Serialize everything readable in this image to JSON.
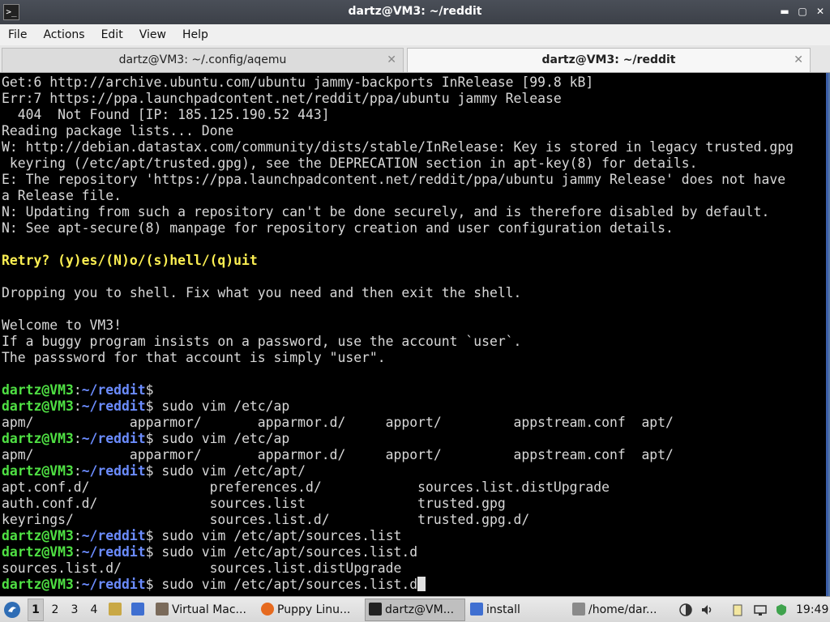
{
  "window": {
    "title": "dartz@VM3: ~/reddit",
    "app_icon": "terminal-icon",
    "buttons": [
      "minimize-icon",
      "maximize-icon",
      "close-icon"
    ]
  },
  "menu": [
    "File",
    "Actions",
    "Edit",
    "View",
    "Help"
  ],
  "tabs": [
    {
      "label": "dartz@VM3: ~/.config/aqemu",
      "active": false
    },
    {
      "label": "dartz@VM3: ~/reddit",
      "active": true
    }
  ],
  "terminal": {
    "prompt_user": "dartz@VM3",
    "prompt_path": "~/reddit",
    "lines": [
      {
        "t": "Get:6 http://archive.ubuntu.com/ubuntu jammy-backports InRelease [99.8 kB]"
      },
      {
        "t": "Err:7 https://ppa.launchpadcontent.net/reddit/ppa/ubuntu jammy Release"
      },
      {
        "t": "  404  Not Found [IP: 185.125.190.52 443]"
      },
      {
        "t": "Reading package lists... Done"
      },
      {
        "t": "W: http://debian.datastax.com/community/dists/stable/InRelease: Key is stored in legacy trusted.gpg"
      },
      {
        "t": " keyring (/etc/apt/trusted.gpg), see the DEPRECATION section in apt-key(8) for details."
      },
      {
        "t": "E: The repository 'https://ppa.launchpadcontent.net/reddit/ppa/ubuntu jammy Release' does not have"
      },
      {
        "t": "a Release file."
      },
      {
        "t": "N: Updating from such a repository can't be done securely, and is therefore disabled by default."
      },
      {
        "t": "N: See apt-secure(8) manpage for repository creation and user configuration details."
      },
      {
        "t": ""
      },
      {
        "t": "Retry? (y)es/(N)o/(s)hell/(q)uit",
        "style": "yellow"
      },
      {
        "t": ""
      },
      {
        "t": "Dropping you to shell. Fix what you need and then exit the shell."
      },
      {
        "t": ""
      },
      {
        "t": "Welcome to VM3!"
      },
      {
        "t": "If a buggy program insists on a password, use the account `user`."
      },
      {
        "t": "The passsword for that account is simply \"user\"."
      },
      {
        "t": ""
      },
      {
        "prompt": true,
        "cmd": ""
      },
      {
        "prompt": true,
        "cmd": " sudo vim /etc/ap"
      },
      {
        "t": "apm/            apparmor/       apparmor.d/     apport/         appstream.conf  apt/"
      },
      {
        "prompt": true,
        "cmd": " sudo vim /etc/ap"
      },
      {
        "t": "apm/            apparmor/       apparmor.d/     apport/         appstream.conf  apt/"
      },
      {
        "prompt": true,
        "cmd": " sudo vim /etc/apt/"
      },
      {
        "t": "apt.conf.d/               preferences.d/            sources.list.distUpgrade"
      },
      {
        "t": "auth.conf.d/              sources.list              trusted.gpg"
      },
      {
        "t": "keyrings/                 sources.list.d/           trusted.gpg.d/"
      },
      {
        "prompt": true,
        "cmd": " sudo vim /etc/apt/sources.list"
      },
      {
        "prompt": true,
        "cmd": " sudo vim /etc/apt/sources.list.d"
      },
      {
        "t": "sources.list.d/           sources.list.distUpgrade"
      },
      {
        "prompt": true,
        "cmd": " sudo vim /etc/apt/sources.list.d",
        "cursor": true
      }
    ]
  },
  "taskbar": {
    "menu_icon": "start-menu-icon",
    "workspaces": [
      "1",
      "2",
      "3",
      "4"
    ],
    "active_workspace": 0,
    "tasks": [
      {
        "label": "Virtual Mac...",
        "icon": "virtual-machine-icon",
        "active": false
      },
      {
        "label": "Puppy Linu...",
        "icon": "firefox-icon",
        "active": false
      },
      {
        "label": "dartz@VM...",
        "icon": "terminal-icon",
        "active": true
      },
      {
        "label": "install",
        "icon": "folder-icon",
        "active": false
      },
      {
        "label": "/home/dar...",
        "icon": "text-editor-icon",
        "active": false
      }
    ],
    "clock": "19:49"
  },
  "colors": {
    "prompt_user": "#4fe043",
    "prompt_path": "#6b8cff",
    "highlight": "#fcef52",
    "terminal_bg": "#000000"
  }
}
